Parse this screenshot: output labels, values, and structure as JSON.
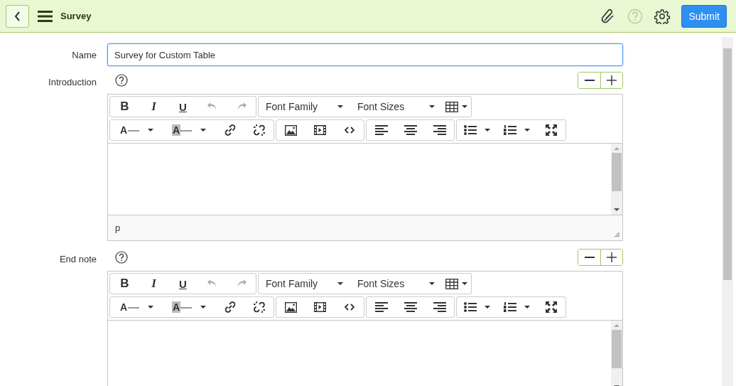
{
  "header": {
    "title": "Survey",
    "submit": "Submit"
  },
  "name_field": {
    "label": "Name",
    "value": "Survey for Custom Table",
    "focused": true
  },
  "editors": [
    {
      "label": "Introduction",
      "status_path": "p",
      "toolbar": [
        [
          [
            {
              "kind": "bold",
              "text": "B",
              "disabled": false
            },
            {
              "kind": "italic",
              "text": "I",
              "disabled": false
            },
            {
              "kind": "underline",
              "text": "U",
              "disabled": false
            },
            {
              "kind": "undo",
              "disabled": true
            },
            {
              "kind": "redo",
              "disabled": true
            }
          ],
          [
            {
              "kind": "select",
              "text": "Font Family",
              "disabled": false
            },
            {
              "kind": "select",
              "text": "Font Sizes",
              "disabled": false
            },
            {
              "kind": "table",
              "disabled": false
            }
          ]
        ],
        [
          [
            {
              "kind": "forecolor",
              "text": "A",
              "disabled": false
            },
            {
              "kind": "backcolor",
              "text": "A",
              "disabled": false
            },
            {
              "kind": "link",
              "disabled": false
            },
            {
              "kind": "unlink",
              "disabled": false
            }
          ],
          [
            {
              "kind": "image",
              "disabled": false
            },
            {
              "kind": "media",
              "disabled": false
            },
            {
              "kind": "code",
              "disabled": false
            }
          ],
          [
            {
              "kind": "alignleft",
              "disabled": false
            },
            {
              "kind": "aligncenter",
              "disabled": false
            },
            {
              "kind": "alignright",
              "disabled": false
            }
          ],
          [
            {
              "kind": "bullist",
              "disabled": false
            },
            {
              "kind": "numlist",
              "disabled": false
            },
            {
              "kind": "fullscreen",
              "disabled": false
            }
          ]
        ]
      ]
    },
    {
      "label": "End note",
      "toolbar": [
        [
          [
            {
              "kind": "bold",
              "text": "B",
              "disabled": false
            },
            {
              "kind": "italic",
              "text": "I",
              "disabled": false
            },
            {
              "kind": "underline",
              "text": "U",
              "disabled": false
            },
            {
              "kind": "undo",
              "disabled": true
            },
            {
              "kind": "redo",
              "disabled": true
            }
          ],
          [
            {
              "kind": "select",
              "text": "Font Family",
              "disabled": false
            },
            {
              "kind": "select",
              "text": "Font Sizes",
              "disabled": false
            },
            {
              "kind": "table",
              "disabled": false
            }
          ]
        ],
        [
          [
            {
              "kind": "forecolor",
              "text": "A",
              "disabled": false
            },
            {
              "kind": "backcolor",
              "text": "A",
              "disabled": false
            },
            {
              "kind": "link",
              "disabled": false
            },
            {
              "kind": "unlink",
              "disabled": false
            }
          ],
          [
            {
              "kind": "image",
              "disabled": false
            },
            {
              "kind": "media",
              "disabled": false
            },
            {
              "kind": "code",
              "disabled": false
            }
          ],
          [
            {
              "kind": "alignleft",
              "disabled": false
            },
            {
              "kind": "aligncenter",
              "disabled": false
            },
            {
              "kind": "alignright",
              "disabled": false
            }
          ],
          [
            {
              "kind": "bullist",
              "disabled": false
            },
            {
              "kind": "numlist",
              "disabled": false
            },
            {
              "kind": "fullscreen",
              "disabled": false
            }
          ]
        ]
      ]
    }
  ]
}
